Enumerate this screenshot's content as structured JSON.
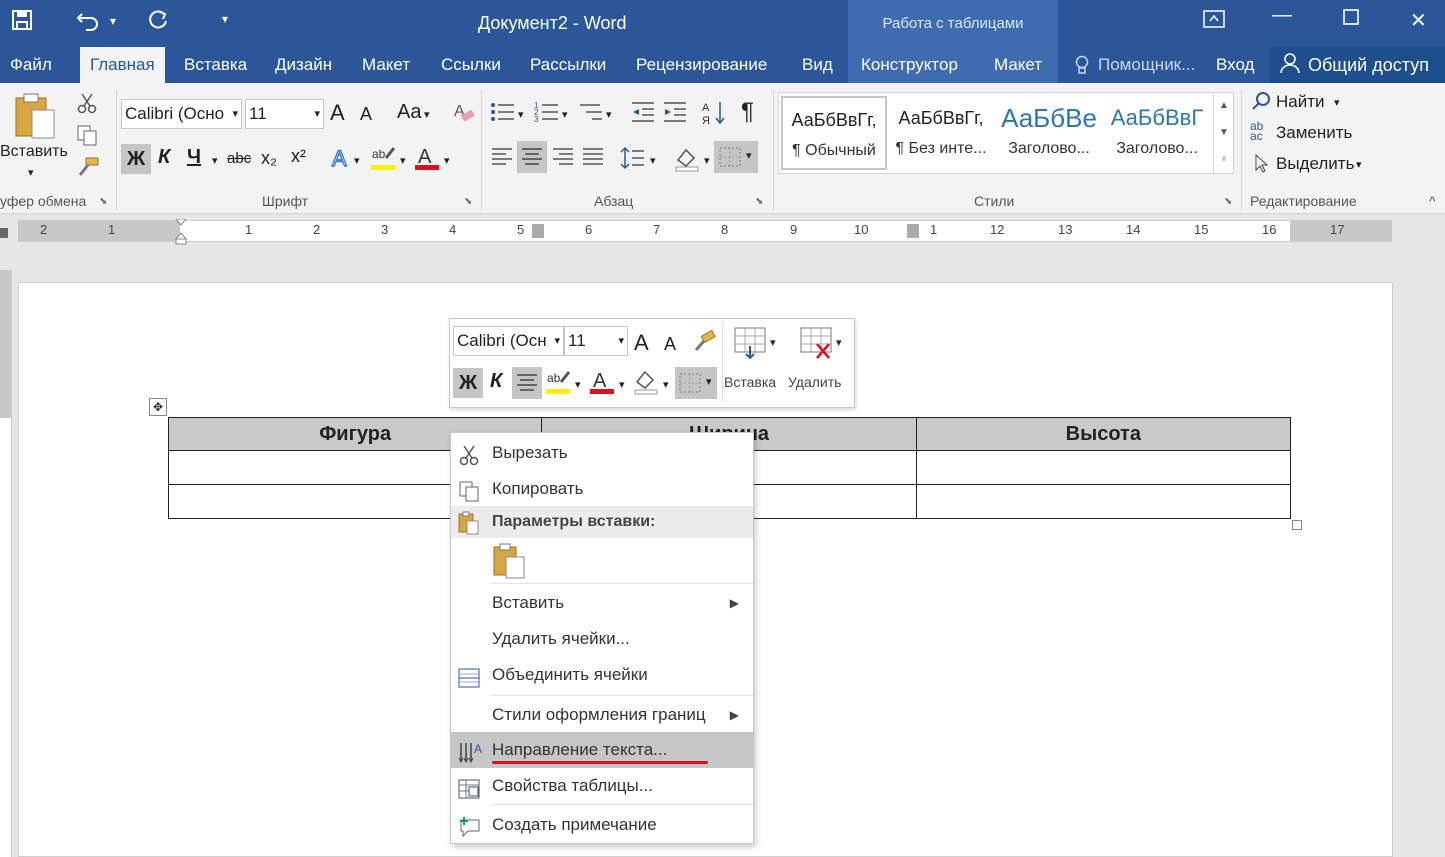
{
  "titlebar": {
    "title": "Документ2 - Word",
    "context_group": "Работа с таблицами"
  },
  "tabs": {
    "file": "Файл",
    "home": "Главная",
    "insert": "Вставка",
    "design": "Дизайн",
    "layout": "Макет",
    "references": "Ссылки",
    "mailings": "Рассылки",
    "review": "Рецензирование",
    "view": "Вид",
    "table_design": "Конструктор",
    "table_layout": "Макет",
    "tell_me": "Помощник...",
    "signin": "Вход",
    "share": "Общий доступ"
  },
  "ribbon": {
    "clipboard": {
      "paste": "Вставить",
      "label": "уфер обмена"
    },
    "font": {
      "name": "Calibri (Осно",
      "size": "11",
      "bold": "Ж",
      "italic": "К",
      "underline": "Ч",
      "strike": "abc",
      "sub": "x₂",
      "sup": "x²",
      "grow": "A",
      "shrink": "A",
      "case": "Aa",
      "label": "Шрифт"
    },
    "paragraph": {
      "label": "Абзац"
    },
    "styles": {
      "label": "Стили",
      "items": [
        {
          "sample": "АаБбВвГг,",
          "name": "¶ Обычный"
        },
        {
          "sample": "АаБбВвГг,",
          "name": "¶ Без инте..."
        },
        {
          "sample": "АаБбВе",
          "name": "Заголово..."
        },
        {
          "sample": "АаБбВвГ",
          "name": "Заголово..."
        }
      ]
    },
    "editing": {
      "label": "Редактирование",
      "find": "Найти",
      "replace": "Заменить",
      "select": "Выделить"
    }
  },
  "ruler": {
    "numbers": [
      "2",
      "1",
      "1",
      "2",
      "3",
      "4",
      "5",
      "6",
      "7",
      "8",
      "9",
      "10",
      "1",
      "12",
      "13",
      "14",
      "15",
      "16",
      "17"
    ]
  },
  "document": {
    "table": {
      "headers": [
        "Фигура",
        "Ширина",
        "Высота"
      ],
      "rows": [
        [
          "",
          "",
          ""
        ],
        [
          "",
          "",
          ""
        ]
      ]
    }
  },
  "mini_toolbar": {
    "font": "Calibri (Осн",
    "size": "11",
    "bold": "Ж",
    "italic": "К",
    "insert": "Вставка",
    "delete": "Удалить"
  },
  "context_menu": {
    "cut": "Вырезать",
    "copy": "Копировать",
    "paste_options": "Параметры вставки:",
    "insert": "Вставить",
    "delete_cells": "Удалить ячейки...",
    "merge_cells": "Объединить ячейки",
    "border_styles": "Стили оформления границ",
    "text_direction": "Направление текста...",
    "table_properties": "Свойства таблицы...",
    "new_comment": "Создать примечание"
  },
  "colors": {
    "word_blue": "#2b579a",
    "highlight": "#c6c6c6",
    "underline_red": "#e0101a"
  }
}
